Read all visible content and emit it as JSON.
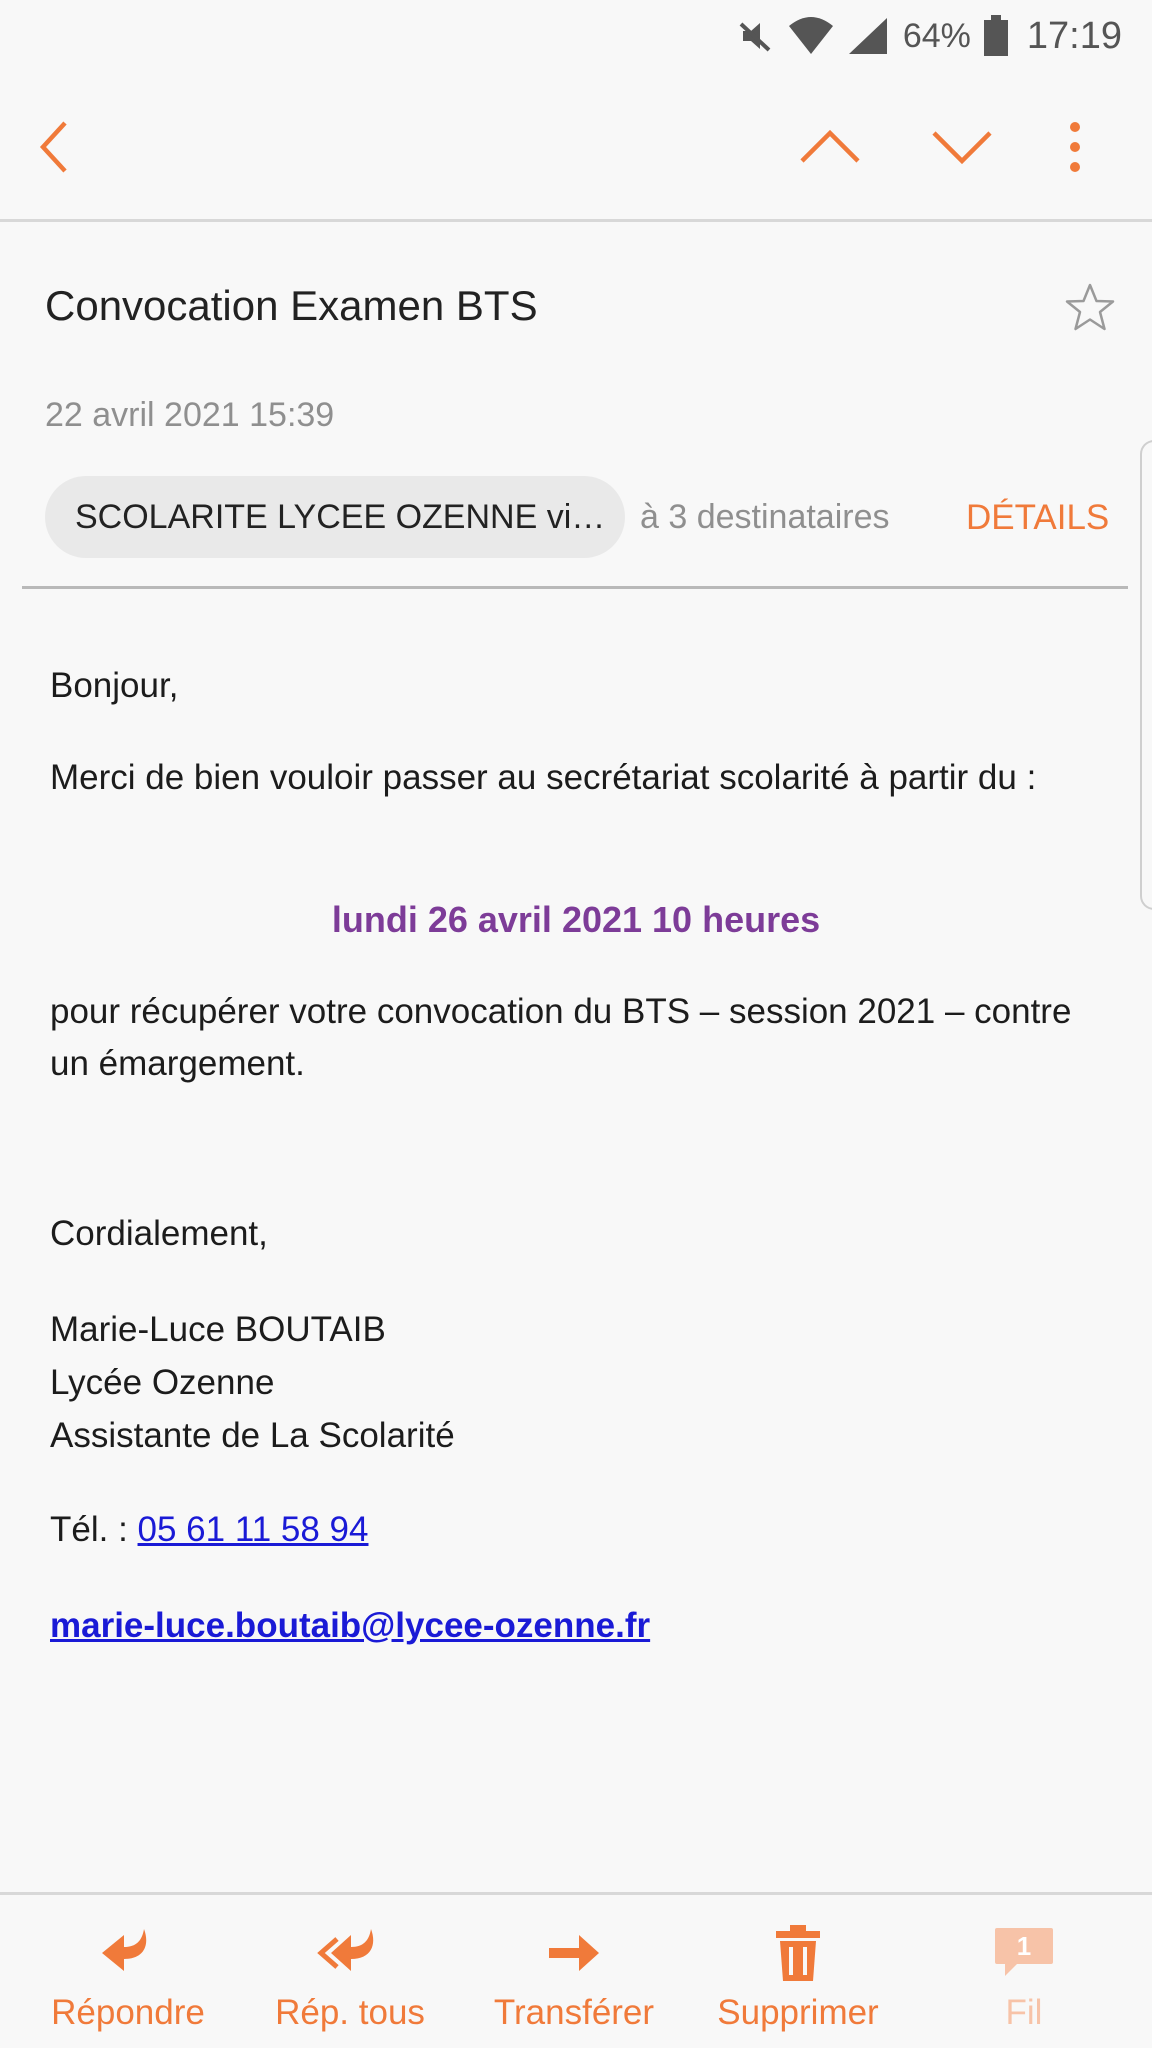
{
  "status_bar": {
    "battery_percent": "64%",
    "time": "17:19",
    "icons": [
      "mute-icon",
      "wifi-icon",
      "signal-icon",
      "battery-icon"
    ]
  },
  "toolbar": {
    "icons": [
      "back-arrow-icon",
      "chevron-up-icon",
      "chevron-down-icon",
      "more-vert-icon"
    ]
  },
  "message": {
    "subject": "Convocation Examen BTS",
    "datetime": "22 avril 2021  15:39",
    "sender": "SCOLARITE LYCEE OZENNE vi…",
    "recipients": "à 3 destinataires",
    "details_label": "DÉTAILS"
  },
  "body": {
    "greeting": "Bonjour,",
    "line1": "Merci de bien vouloir passer au secrétariat scolarité à partir du  :",
    "highlight": "lundi 26 avril 2021  10 heures",
    "line2": "pour récupérer votre convocation du BTS – session 2021 – contre un émargement.",
    "closing": "Cordialement,",
    "sig_name": "Marie-Luce BOUTAIB",
    "sig_org": "Lycée Ozenne",
    "sig_role": "Assistante de La Scolarité",
    "tel_label": "Tél. : ",
    "tel": "05 61 11 58 94",
    "email": "marie-luce.boutaib@lycee-ozenne.fr"
  },
  "actions": {
    "reply": "Répondre",
    "reply_all": "Rép. tous",
    "forward": "Transférer",
    "delete": "Supprimer",
    "thread": "Fil",
    "thread_badge": "1"
  },
  "colors": {
    "accent": "#f07a3a",
    "highlight_text": "#7d3c98",
    "link": "#1a1ad6"
  }
}
